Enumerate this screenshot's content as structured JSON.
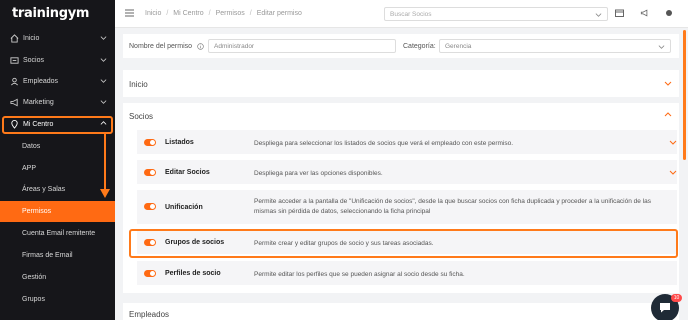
{
  "app": {
    "logo": "trainingym"
  },
  "sidebar": {
    "items": [
      {
        "label": "Inicio"
      },
      {
        "label": "Socios"
      },
      {
        "label": "Empleados"
      },
      {
        "label": "Marketing"
      },
      {
        "label": "Mi Centro"
      }
    ],
    "subitems": [
      {
        "label": "Datos"
      },
      {
        "label": "APP"
      },
      {
        "label": "Áreas y Salas"
      },
      {
        "label": "Permisos"
      },
      {
        "label": "Cuenta Email remitente"
      },
      {
        "label": "Firmas de Email"
      },
      {
        "label": "Gestión"
      },
      {
        "label": "Grupos"
      }
    ]
  },
  "topbar": {
    "breadcrumb": [
      "Inicio",
      "Mi Centro",
      "Permisos",
      "Editar permiso"
    ],
    "search_placeholder": "Buscar Socios"
  },
  "form": {
    "name_label": "Nombre del permiso",
    "name_value": "Administrador",
    "category_label": "Categoría:",
    "category_value": "Gerencia"
  },
  "sections": {
    "inicio": "Inicio",
    "socios": "Socios",
    "empleados": "Empleados"
  },
  "rows": [
    {
      "title": "Listados",
      "desc": "Despliega para seleccionar los listados de socios que verá el empleado con este permiso."
    },
    {
      "title": "Editar Socios",
      "desc": "Despliega para ver las opciones disponibles."
    },
    {
      "title": "Unificación",
      "desc": "Permite acceder a la pantalla de \"Unificación de socios\", desde la que buscar socios con ficha duplicada y proceder a la unificación de las mismas sin pérdida de datos, seleccionando la ficha principal"
    },
    {
      "title": "Grupos de socios",
      "desc": "Permite crear y editar grupos de socio y sus tareas asociadas."
    },
    {
      "title": "Perfiles de socio",
      "desc": "Permite editar los perfiles que se pueden asignar al socio desde su ficha."
    }
  ],
  "chat": {
    "badge": "10"
  },
  "colors": {
    "accent": "#ff6a13",
    "sidebar_bg": "#16161a"
  }
}
